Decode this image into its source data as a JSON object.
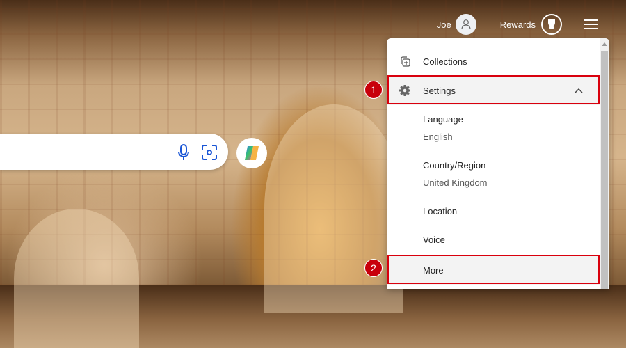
{
  "header": {
    "user_name": "Joe",
    "rewards_label": "Rewards"
  },
  "menu": {
    "collections": "Collections",
    "settings": "Settings",
    "language_label": "Language",
    "language_value": "English",
    "region_label": "Country/Region",
    "region_value": "United Kingdom",
    "location": "Location",
    "voice": "Voice",
    "more": "More"
  },
  "annotations": {
    "step1": "1",
    "step2": "2"
  },
  "colors": {
    "highlight": "#d9000d",
    "badge": "#c8000b",
    "icon_blue": "#1a56d6"
  }
}
